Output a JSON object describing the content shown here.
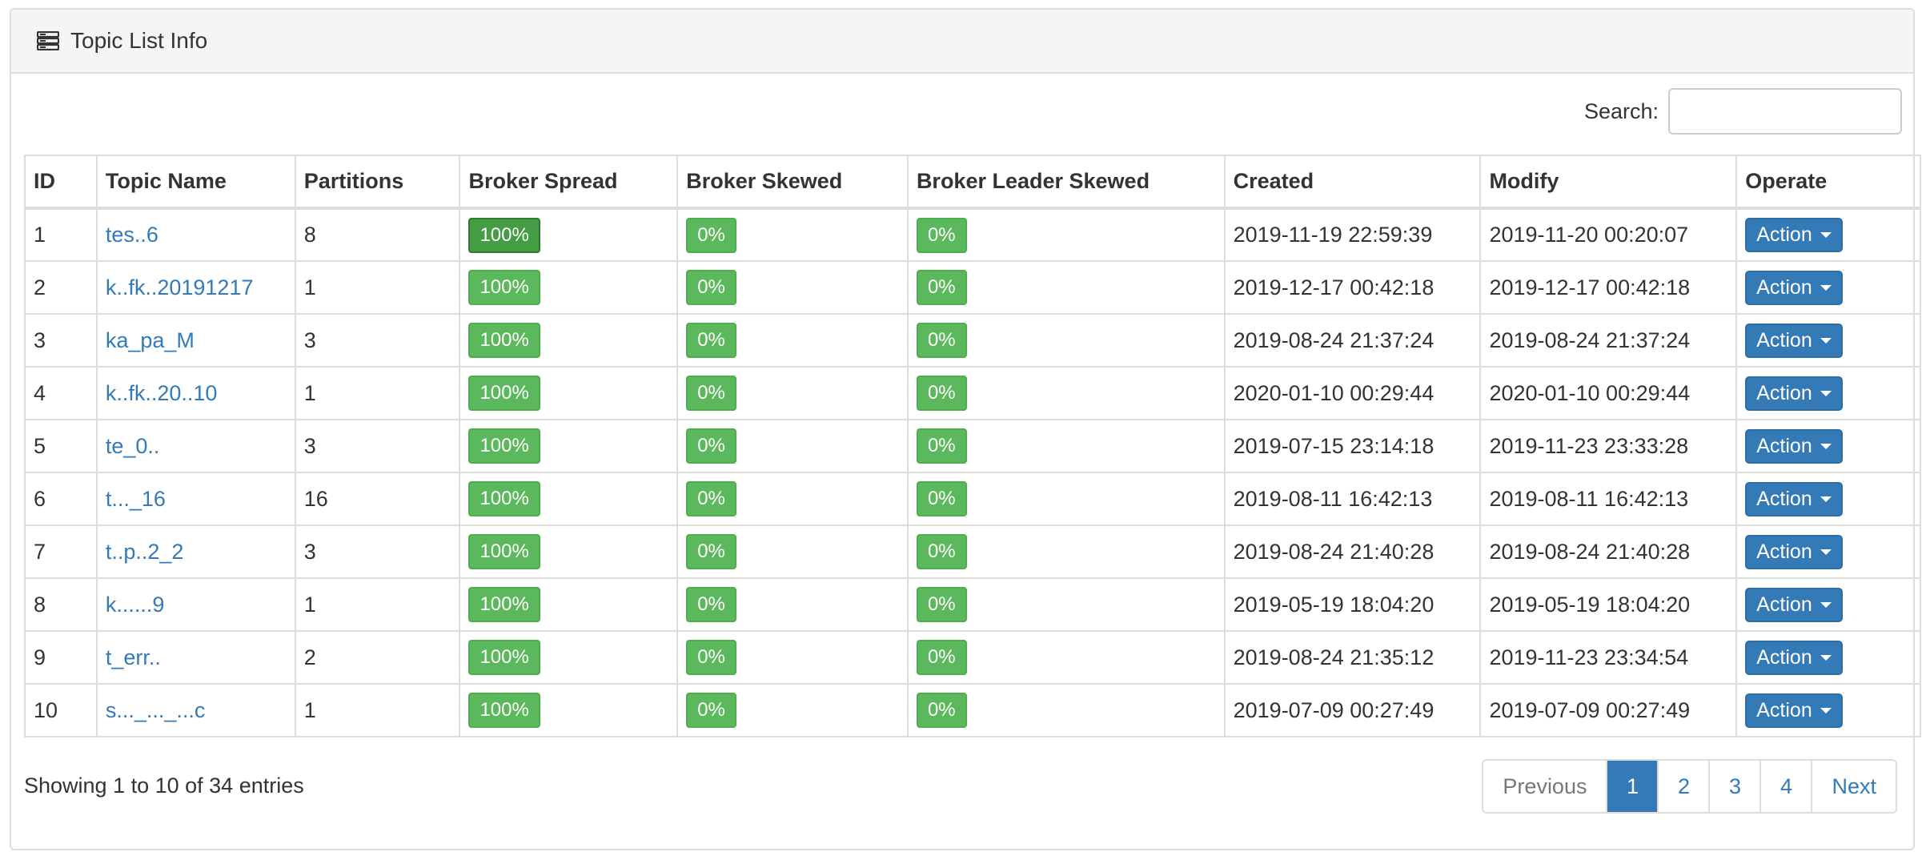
{
  "panel": {
    "title": "Topic List Info",
    "icon": "server-list-icon"
  },
  "search": {
    "label": "Search:",
    "value": "",
    "placeholder": ""
  },
  "table": {
    "headers": {
      "id": "ID",
      "name": "Topic Name",
      "partitions": "Partitions",
      "spread": "Broker Spread",
      "skewed": "Broker Skewed",
      "leader_skewed": "Broker Leader Skewed",
      "created": "Created",
      "modify": "Modify",
      "operate": "Operate"
    },
    "action_label": "Action",
    "rows": [
      {
        "id": "1",
        "name": "tes..6",
        "partitions": "8",
        "spread": "100%",
        "skewed": "0%",
        "leader_skewed": "0%",
        "created": "2019-11-19 22:59:39",
        "modify": "2019-11-20 00:20:07"
      },
      {
        "id": "2",
        "name": "k..fk..20191217",
        "partitions": "1",
        "spread": "100%",
        "skewed": "0%",
        "leader_skewed": "0%",
        "created": "2019-12-17 00:42:18",
        "modify": "2019-12-17 00:42:18"
      },
      {
        "id": "3",
        "name": "ka_pa_M",
        "partitions": "3",
        "spread": "100%",
        "skewed": "0%",
        "leader_skewed": "0%",
        "created": "2019-08-24 21:37:24",
        "modify": "2019-08-24 21:37:24"
      },
      {
        "id": "4",
        "name": "k..fk..20..10",
        "partitions": "1",
        "spread": "100%",
        "skewed": "0%",
        "leader_skewed": "0%",
        "created": "2020-01-10 00:29:44",
        "modify": "2020-01-10 00:29:44"
      },
      {
        "id": "5",
        "name": "te_0..",
        "partitions": "3",
        "spread": "100%",
        "skewed": "0%",
        "leader_skewed": "0%",
        "created": "2019-07-15 23:14:18",
        "modify": "2019-11-23 23:33:28"
      },
      {
        "id": "6",
        "name": "t..._16",
        "partitions": "16",
        "spread": "100%",
        "skewed": "0%",
        "leader_skewed": "0%",
        "created": "2019-08-11 16:42:13",
        "modify": "2019-08-11 16:42:13"
      },
      {
        "id": "7",
        "name": "t..p..2_2",
        "partitions": "3",
        "spread": "100%",
        "skewed": "0%",
        "leader_skewed": "0%",
        "created": "2019-08-24 21:40:28",
        "modify": "2019-08-24 21:40:28"
      },
      {
        "id": "8",
        "name": "k......9",
        "partitions": "1",
        "spread": "100%",
        "skewed": "0%",
        "leader_skewed": "0%",
        "created": "2019-05-19 18:04:20",
        "modify": "2019-05-19 18:04:20"
      },
      {
        "id": "9",
        "name": "t_err..",
        "partitions": "2",
        "spread": "100%",
        "skewed": "0%",
        "leader_skewed": "0%",
        "created": "2019-08-24 21:35:12",
        "modify": "2019-11-23 23:34:54"
      },
      {
        "id": "10",
        "name": "s..._..._...c",
        "partitions": "1",
        "spread": "100%",
        "skewed": "0%",
        "leader_skewed": "0%",
        "created": "2019-07-09 00:27:49",
        "modify": "2019-07-09 00:27:49"
      }
    ]
  },
  "footer": {
    "info": "Showing 1 to 10 of 34 entries"
  },
  "pagination": {
    "previous": "Previous",
    "pages": [
      "1",
      "2",
      "3",
      "4"
    ],
    "active_page": "1",
    "next": "Next"
  },
  "colors": {
    "link": "#337ab7",
    "label_success": "#5cb85c",
    "label_highlight": "#449d44",
    "button_primary": "#337ab7"
  }
}
